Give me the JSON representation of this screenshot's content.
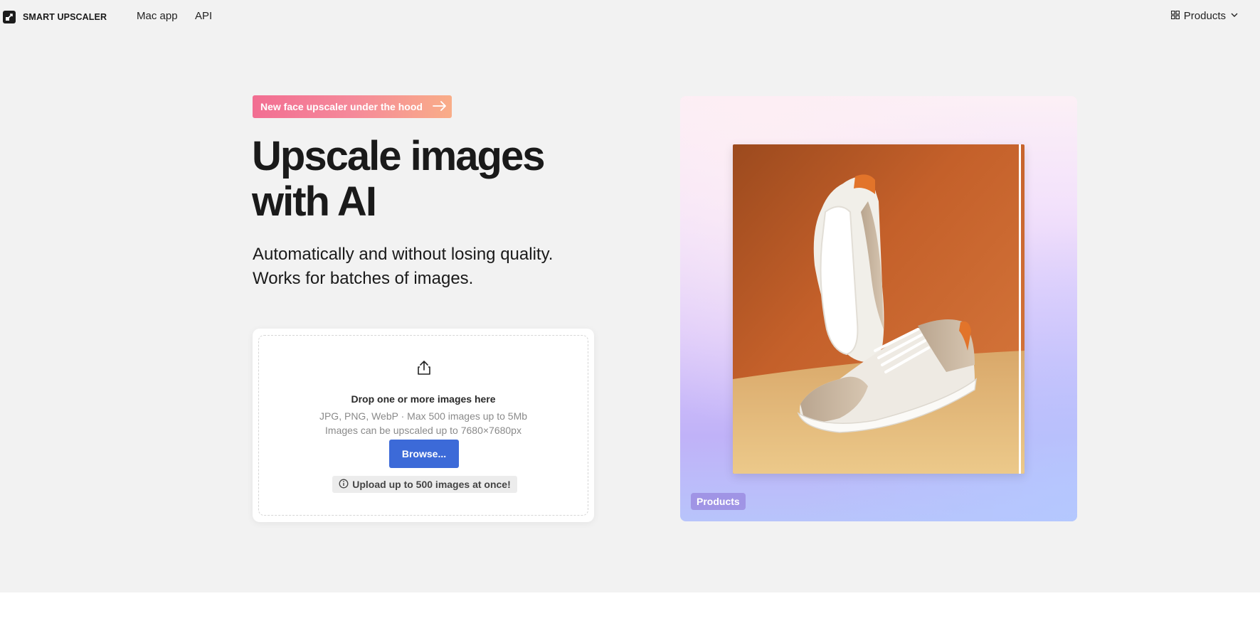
{
  "header": {
    "logo_text": "SMART UPSCALER",
    "nav": [
      {
        "label": "Mac app"
      },
      {
        "label": "API"
      }
    ],
    "products_label": "Products"
  },
  "hero": {
    "announcement": "New face upscaler under the hood",
    "headline_line1": "Upscale images",
    "headline_line2": "with AI",
    "subhead_line1": "Automatically and without losing quality.",
    "subhead_line2": "Works for batches of images."
  },
  "upload": {
    "title": "Drop one or more images here",
    "formats": "JPG, PNG, WebP · Max 500 images up to 5Mb",
    "limit": "Images can be upscaled up to 7680×7680px",
    "browse_label": "Browse...",
    "note": "Upload up to 500 images at once!"
  },
  "preview": {
    "tag_label": "Products"
  },
  "colors": {
    "accent": "#3c6ad8",
    "hero_background": "#f2f2f2",
    "announcement_gradient": [
      "#f26e92",
      "#f9ad88"
    ]
  }
}
